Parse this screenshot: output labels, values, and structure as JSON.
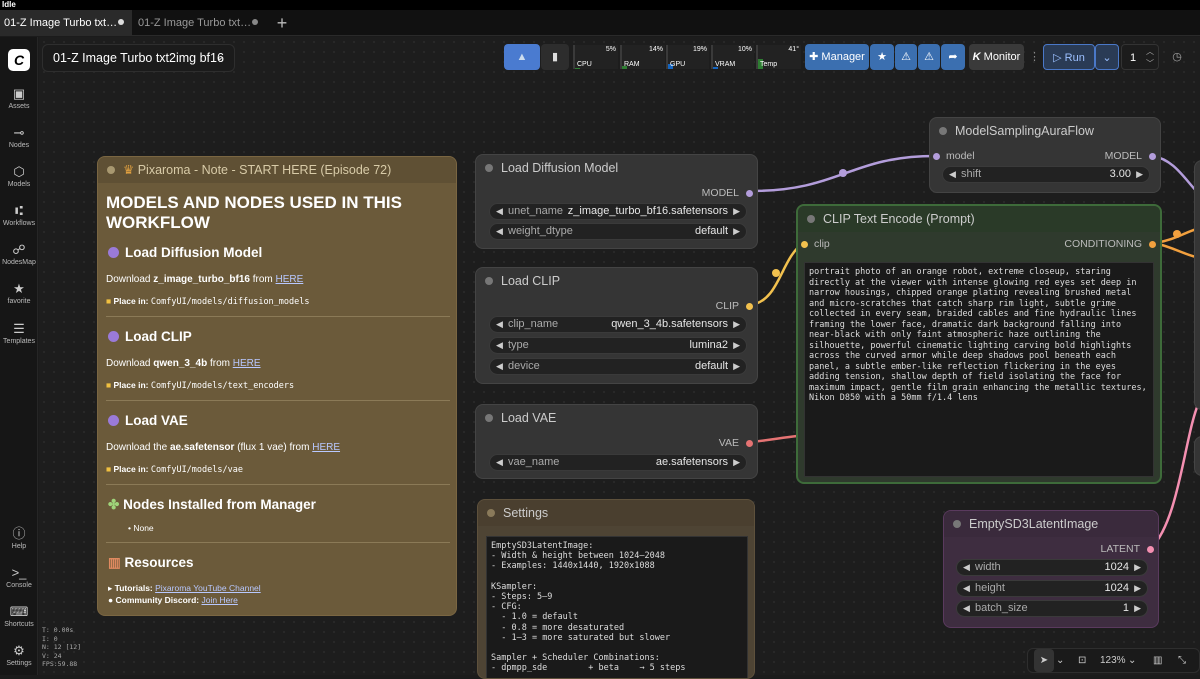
{
  "status": "Idle",
  "tabs": [
    {
      "label": "01-Z Image Turbo txt…"
    },
    {
      "label": "01-Z Image Turbo txt…"
    }
  ],
  "sidebar": {
    "items": [
      {
        "label": "Assets"
      },
      {
        "label": "Nodes"
      },
      {
        "label": "Models"
      },
      {
        "label": "Workflows"
      },
      {
        "label": "NodesMap"
      },
      {
        "label": "favorite"
      },
      {
        "label": "Templates"
      }
    ],
    "bottom": [
      {
        "label": "Help"
      },
      {
        "label": "Console"
      },
      {
        "label": "Shortcuts"
      },
      {
        "label": "Settings"
      }
    ]
  },
  "workflow_title": "01-Z Image Turbo txt2img bf16",
  "meters": [
    {
      "label": "CPU",
      "value": "5%",
      "level": 0.05,
      "color": "#2e7d32"
    },
    {
      "label": "RAM",
      "value": "14%",
      "level": 0.14,
      "color": "#2e7d32"
    },
    {
      "label": "GPU",
      "value": "19%",
      "level": 0.19,
      "color": "#1565c0"
    },
    {
      "label": "VRAM",
      "value": "10%",
      "level": 0.1,
      "color": "#1565c0"
    },
    {
      "label": "Temp",
      "value": "41°",
      "level": 0.41,
      "color": "#2e7d32"
    }
  ],
  "toolbar": {
    "manager": "Manager",
    "monitor": "Monitor",
    "run": "Run",
    "batch": "1",
    "zoom": "123%"
  },
  "stats": [
    "T: 0.00s",
    "I: 0",
    "N: 12 [12]",
    "V: 24",
    "FPS:59.88"
  ],
  "note": {
    "title": "Pixaroma - Note - START HERE (Episode 72)",
    "heading": "MODELS AND NODES USED IN THIS WORKFLOW",
    "sections": [
      {
        "name": "Load Diffusion Model",
        "dl_pre": "Download ",
        "file": "z_image_turbo_bf16",
        "dl_mid": " from ",
        "link": "HERE",
        "place_label": "Place in:",
        "place": "ComfyUI/models/diffusion_models"
      },
      {
        "name": "Load CLIP",
        "dl_pre": "Download ",
        "file": "qwen_3_4b",
        "dl_mid": " from ",
        "link": "HERE",
        "place_label": "Place in:",
        "place": "ComfyUI/models/text_encoders"
      },
      {
        "name": "Load VAE",
        "dl_pre": "Download the ",
        "file": "ae.safetensor",
        "dl_mid": " (flux 1 vae) from ",
        "link": "HERE",
        "place_label": "Place in:",
        "place": "ComfyUI/models/vae"
      }
    ],
    "nodes_heading": "Nodes Installed from Manager",
    "nodes_item": "None",
    "resources_heading": "Resources",
    "tutorials_label": "Tutorials:",
    "tutorials_link": "Pixaroma YouTube Channel",
    "discord_label": "Community Discord:",
    "discord_link": "Join Here"
  },
  "nodes": {
    "diffusion": {
      "title": "Load Diffusion Model",
      "output": "MODEL",
      "w1": {
        "label": "unet_name",
        "value": "z_image_turbo_bf16.safetensors"
      },
      "w2": {
        "label": "weight_dtype",
        "value": "default"
      }
    },
    "clip": {
      "title": "Load CLIP",
      "output": "CLIP",
      "w1": {
        "label": "clip_name",
        "value": "qwen_3_4b.safetensors"
      },
      "w2": {
        "label": "type",
        "value": "lumina2"
      },
      "w3": {
        "label": "device",
        "value": "default"
      }
    },
    "vae": {
      "title": "Load VAE",
      "output": "VAE",
      "w1": {
        "label": "vae_name",
        "value": "ae.safetensors"
      }
    },
    "settings": {
      "title": "Settings",
      "text": "EmptySD3LatentImage:\n- Width & height between 1024–2048\n- Examples: 1440x1440, 1920x1088\n\nKSampler:\n- Steps: 5–9\n- CFG:\n  - 1.0 = default\n  - 0.8 = more desaturated\n  - 1–3 = more saturated but slower\n\nSampler + Scheduler Combinations:\n- dpmpp_sde        + beta    → 5 steps"
    },
    "msaf": {
      "title": "ModelSamplingAuraFlow",
      "input": "model",
      "output": "MODEL",
      "w1": {
        "label": "shift",
        "value": "3.00"
      }
    },
    "clipenc": {
      "title": "CLIP Text Encode (Prompt)",
      "input": "clip",
      "output": "CONDITIONING",
      "text": "portrait photo of an orange robot, extreme closeup, staring directly at the viewer with intense glowing red eyes set deep in narrow housings, chipped orange plating revealing brushed metal and micro-scratches that catch sharp rim light, subtle grime collected in every seam, braided cables and fine hydraulic lines framing the lower face, dramatic dark background falling into near-black with only faint atmospheric haze outlining the silhouette, powerful cinematic lighting carving bold highlights across the curved armor while deep shadows pool beneath each panel, a subtle ember-like reflection flickering in the eyes adding tension, shallow depth of field isolating the face for maximum impact, gentle film grain enhancing the metallic textures, Nikon D850 with a 50mm f/1.4 lens"
    },
    "latent": {
      "title": "EmptySD3LatentImage",
      "output": "LATENT",
      "w1": {
        "label": "width",
        "value": "1024"
      },
      "w2": {
        "label": "height",
        "value": "1024"
      },
      "w3": {
        "label": "batch_size",
        "value": "1"
      }
    }
  }
}
